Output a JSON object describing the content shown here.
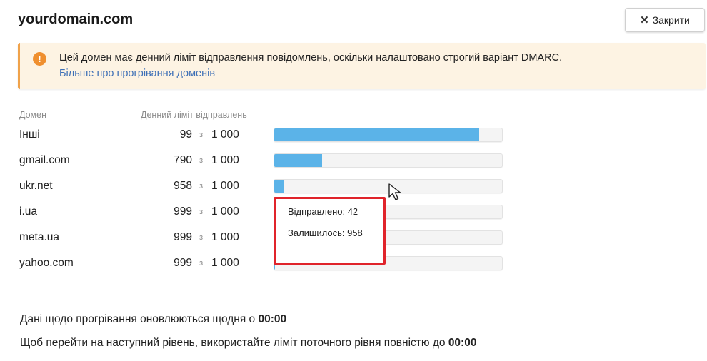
{
  "header": {
    "title": "yourdomain.com",
    "close_label": "Закрити"
  },
  "alert": {
    "icon": "exclamation-icon",
    "color": "#ef8f2f",
    "text": "Цей домен має денний ліміт відправлення повідомлень, оскільки налаштовано строгий варіант DMARC.",
    "link": "Більше про прогрівання доменів"
  },
  "table": {
    "col_domain": "Домен",
    "col_limit": "Денний ліміт відправлень",
    "rows": [
      {
        "domain": "Інші",
        "used": "99",
        "of": "з",
        "limit": "1 000",
        "fill": 0.9
      },
      {
        "domain": "gmail.com",
        "used": "790",
        "of": "з",
        "limit": "1 000",
        "fill": 0.21
      },
      {
        "domain": "ukr.net",
        "used": "958",
        "of": "з",
        "limit": "1 000",
        "fill": 0.042
      },
      {
        "domain": "i.ua",
        "used": "999",
        "of": "з",
        "limit": "1 000",
        "fill": 0.001
      },
      {
        "domain": "meta.ua",
        "used": "999",
        "of": "з",
        "limit": "1 000",
        "fill": 0.001
      },
      {
        "domain": "yahoo.com",
        "used": "999",
        "of": "з",
        "limit": "1 000",
        "fill": 0.001
      }
    ]
  },
  "tooltip": {
    "sent": "Відправлено: 42",
    "remaining": "Залишилось: 958"
  },
  "footer": {
    "line1_text": "Дані щодо прогрівання оновлюються щодня о ",
    "line1_time": "00:00",
    "line2_text": "Щоб перейти на наступний рівень, використайте ліміт поточного рівня повністю до ",
    "line2_time": "00:00"
  },
  "colors": {
    "bar_fill": "#5bb3e8",
    "highlight_border": "#e0242b",
    "alert_accent": "#f0a24a"
  }
}
